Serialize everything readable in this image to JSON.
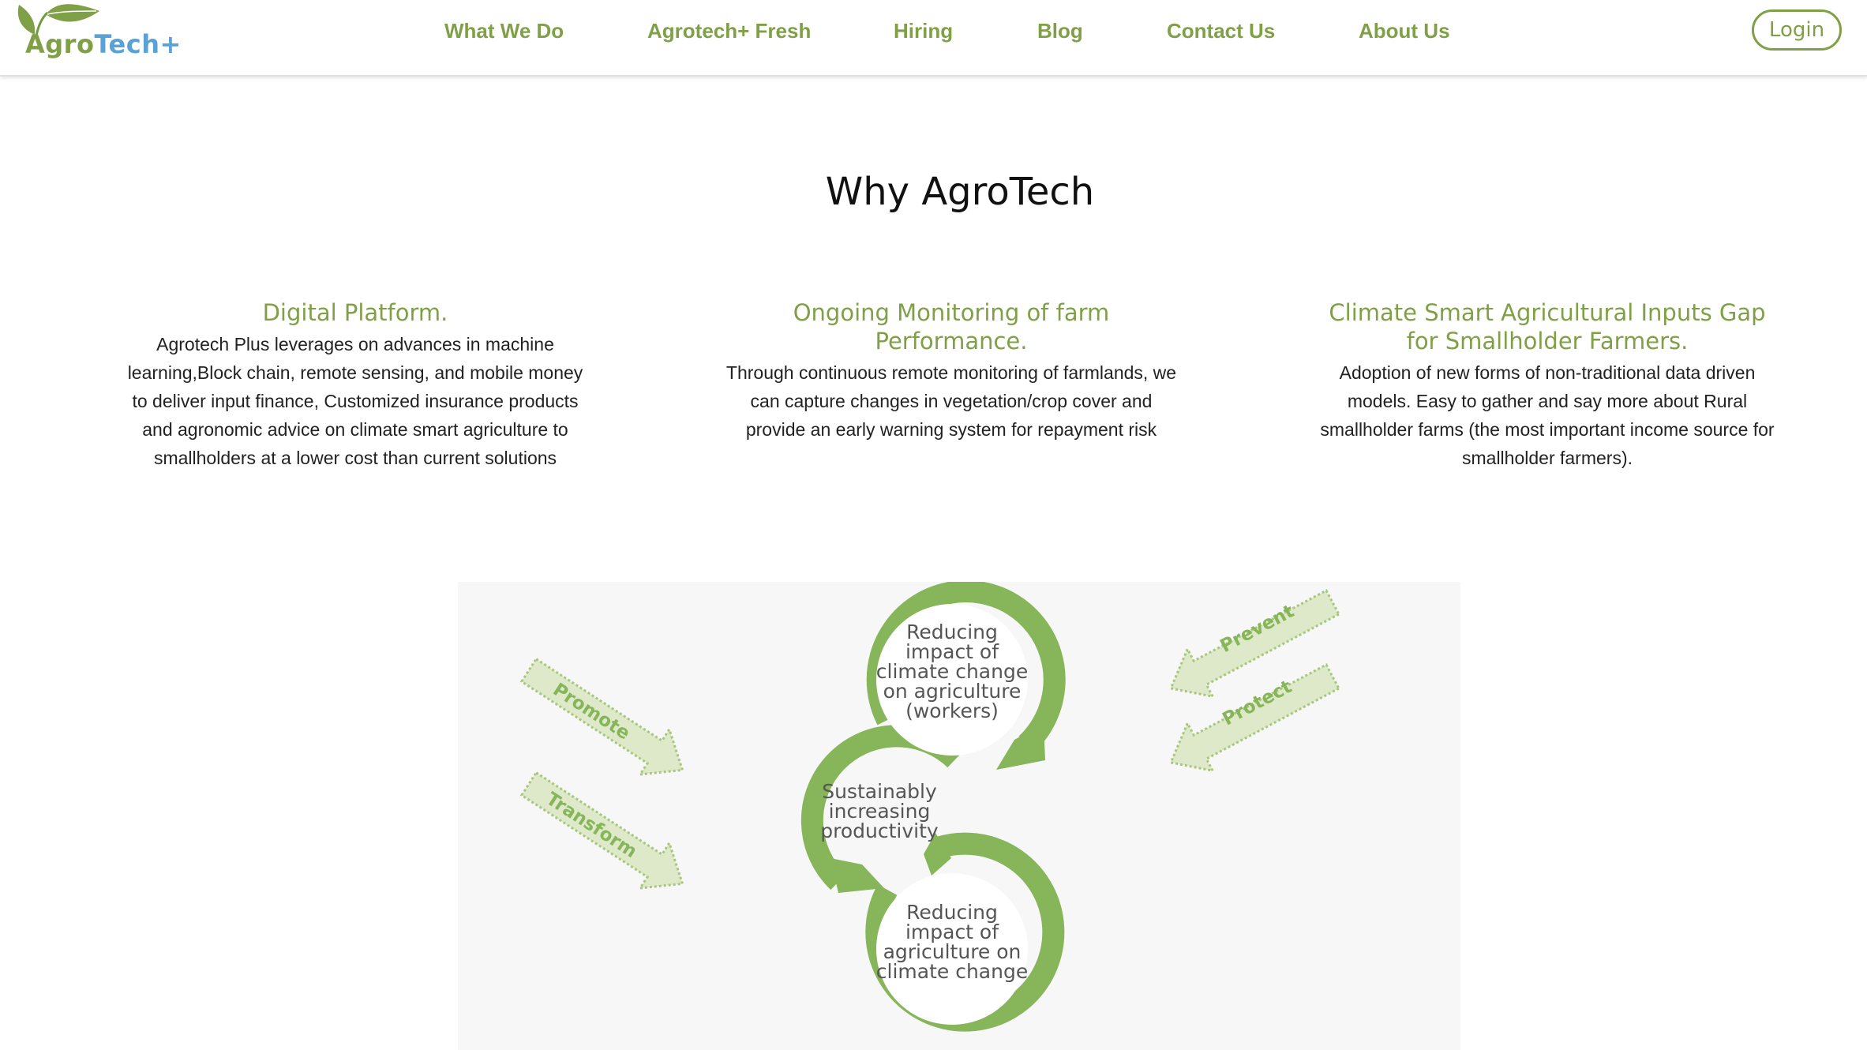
{
  "header": {
    "logo": {
      "part1": "Agro",
      "part2": "Tech+"
    },
    "nav": [
      {
        "label": "What We Do"
      },
      {
        "label": "Agrotech+ Fresh"
      },
      {
        "label": "Hiring"
      },
      {
        "label": "Blog"
      },
      {
        "label": "Contact Us"
      },
      {
        "label": "About Us"
      }
    ],
    "login_label": "Login"
  },
  "section": {
    "title": "Why AgroTech",
    "columns": [
      {
        "title": "Digital Platform.",
        "body": "Agrotech Plus leverages on advances in machine learning,Block chain, remote sensing, and mobile money to deliver input finance, Customized insurance products and agronomic advice on climate smart agriculture to smallholders at a lower cost than current solutions"
      },
      {
        "title": "Ongoing Monitoring of farm Performance.",
        "body": "Through continuous remote monitoring of farmlands, we can capture changes in vegetation/crop cover and provide an early warning system for repayment risk"
      },
      {
        "title": "Climate Smart Agricultural Inputs Gap for Smallholder Farmers.",
        "body": "Adoption of new forms of non-traditional data driven models. Easy to gather and say more about Rural smallholder farms (the most important income source for smallholder farmers)."
      }
    ]
  },
  "diagram": {
    "circle_top": [
      "Reducing",
      "impact of",
      "climate change",
      "on agriculture",
      "(workers)"
    ],
    "circle_middle": [
      "Sustainably",
      "increasing",
      "productivity"
    ],
    "circle_bottom": [
      "Reducing",
      "impact of",
      "agriculture on",
      "climate change"
    ],
    "arrows": {
      "promote": "Promote",
      "transform": "Transform",
      "prevent": "Prevent",
      "protect": "Protect"
    }
  },
  "colors": {
    "brand_green": "#7fa047",
    "brand_blue": "#5aa2d6",
    "diagram_green": "#86b55a",
    "arrow_fill": "#dde9c9"
  }
}
